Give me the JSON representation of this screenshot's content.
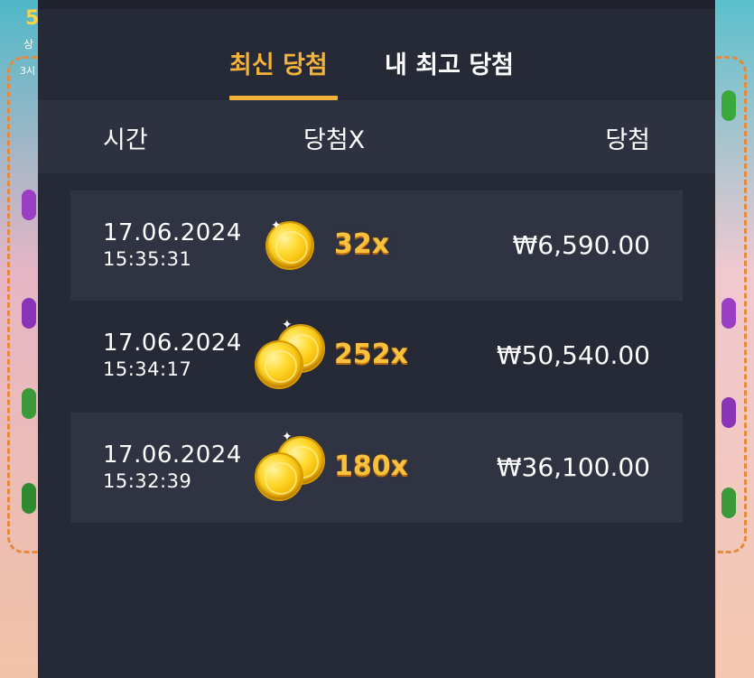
{
  "background": {
    "number": "5",
    "line1": "상",
    "line2": "3시"
  },
  "tabs": [
    {
      "label": "최신 당첨",
      "active": true
    },
    {
      "label": "내 최고 당첨",
      "active": false
    }
  ],
  "table": {
    "columns": [
      "시간",
      "당첨X",
      "당첨"
    ],
    "rows": [
      {
        "date": "17.06.2024",
        "time": "15:35:31",
        "multiplier": "32x",
        "amount": "₩6,590.00",
        "coins": 1
      },
      {
        "date": "17.06.2024",
        "time": "15:34:17",
        "multiplier": "252x",
        "amount": "₩50,540.00",
        "coins": 2
      },
      {
        "date": "17.06.2024",
        "time": "15:32:39",
        "multiplier": "180x",
        "amount": "₩36,100.00",
        "coins": 2
      }
    ]
  },
  "colors": {
    "accent": "#f3b23a",
    "panel": "#262936",
    "header": "#2e3240",
    "row_shade": "#2f3342"
  },
  "icons": {
    "coin": "gold-coin-icon",
    "coins": "gold-coins-stack-icon"
  }
}
